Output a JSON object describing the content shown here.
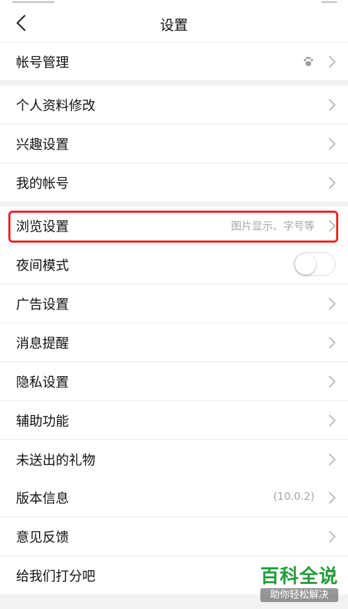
{
  "header": {
    "title": "设置"
  },
  "groups": [
    [
      {
        "label": "帐号管理",
        "sub": "",
        "icon": "baidu-paw-icon"
      }
    ],
    [
      {
        "label": "个人资料修改"
      },
      {
        "label": "兴趣设置"
      },
      {
        "label": "我的帐号"
      }
    ],
    [
      {
        "label": "浏览设置",
        "sub": "图片显示、字号等",
        "highlighted": true
      },
      {
        "label": "夜间模式",
        "toggle": false
      },
      {
        "label": "广告设置"
      },
      {
        "label": "消息提醒"
      },
      {
        "label": "隐私设置"
      },
      {
        "label": "辅助功能"
      },
      {
        "label": "未送出的礼物"
      }
    ],
    [
      {
        "label": "版本信息",
        "sub": "(10.0.2)"
      },
      {
        "label": "意见反馈"
      },
      {
        "label": "给我们打分吧"
      }
    ]
  ],
  "watermark": {
    "title": "百科全说",
    "subtitle": "助你轻松解决"
  },
  "colors": {
    "highlight": "#e8232a",
    "watermark": "#1f9e3a"
  }
}
